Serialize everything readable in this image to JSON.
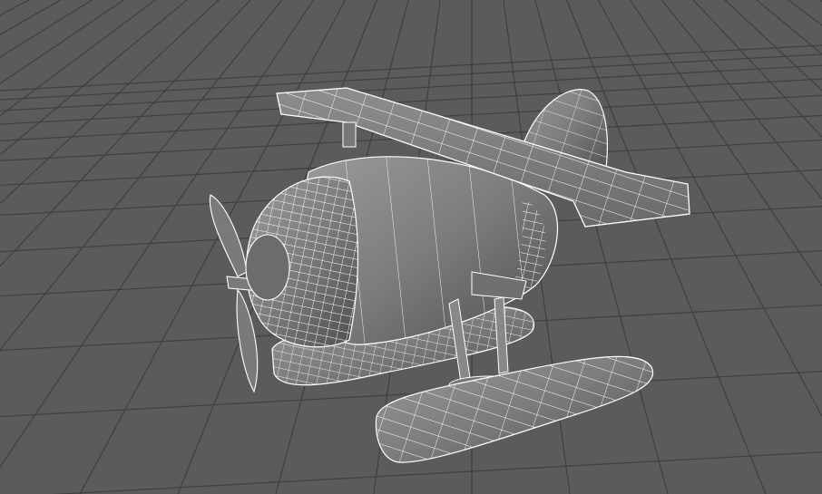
{
  "viewport": {
    "background_color": "#5b5b5b",
    "grid_color": "#3f3f3f",
    "mesh_fill_color": "#8a8a8a",
    "wireframe_color": "#ffffff"
  }
}
